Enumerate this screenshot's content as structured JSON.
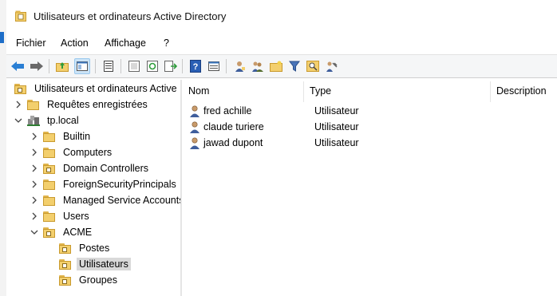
{
  "window": {
    "title": "Utilisateurs et ordinateurs Active Directory"
  },
  "menu": [
    "Fichier",
    "Action",
    "Affichage",
    "?"
  ],
  "toolbar": {
    "icons": [
      "back-arrow-icon",
      "forward-arrow-icon",
      "up-folder-icon",
      "show-tree-icon",
      "properties-icon",
      "export-list-icon",
      "refresh-icon",
      "export-icon",
      "help-icon",
      "details-view-icon",
      "new-user-icon",
      "new-group-icon",
      "new-ou-icon",
      "filter-icon",
      "find-icon",
      "delegate-icon"
    ]
  },
  "tree": {
    "root": "Utilisateurs et ordinateurs Active",
    "saved_queries": "Requêtes enregistrées",
    "domain": "tp.local",
    "items": [
      "Builtin",
      "Computers",
      "Domain Controllers",
      "ForeignSecurityPrincipals",
      "Managed Service Accounts",
      "Users",
      "ACME"
    ],
    "acme_children": [
      "Postes",
      "Utilisateurs",
      "Groupes"
    ],
    "selected": "Utilisateurs"
  },
  "list": {
    "columns": [
      "Nom",
      "Type",
      "Description"
    ],
    "rows": [
      {
        "name": "fred achille",
        "type": "Utilisateur"
      },
      {
        "name": "claude turiere",
        "type": "Utilisateur"
      },
      {
        "name": "jawad dupont",
        "type": "Utilisateur"
      }
    ]
  },
  "colors": {
    "accent": "#1e6ec8",
    "selection": "#d9d9d9",
    "folder": "#f3cf6d"
  }
}
